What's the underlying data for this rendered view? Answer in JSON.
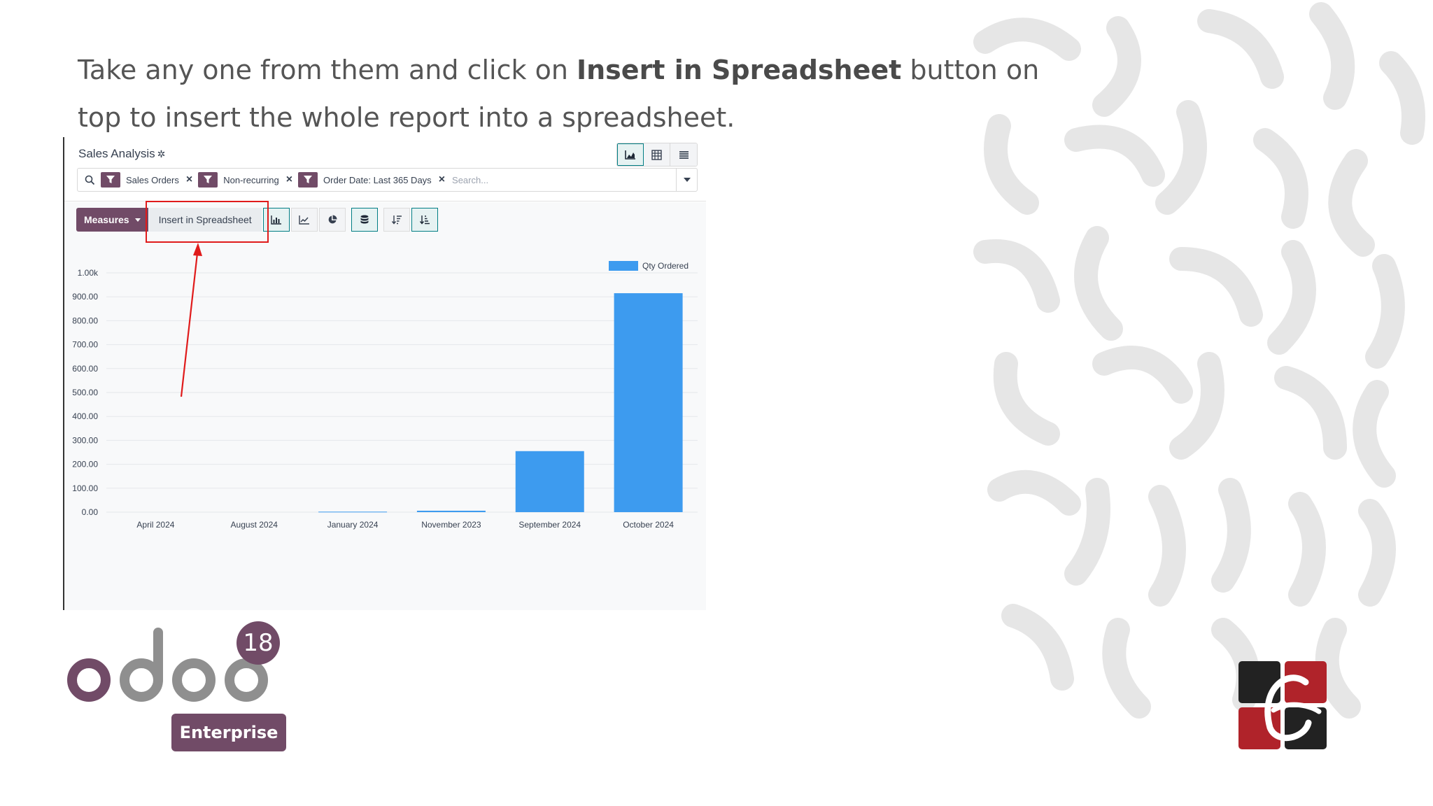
{
  "caption": {
    "part1": "Take any one from them and click on ",
    "bold": "Insert in Spreadsheet",
    "part2": " button on top to insert the whole report into a spreadsheet."
  },
  "odoo_app": {
    "page_title": "Sales Analysis",
    "view_switcher": [
      "graph-view-icon",
      "pivot-view-icon",
      "list-view-icon"
    ],
    "search": {
      "facets": [
        {
          "label": "Sales Orders",
          "icon": "filter-icon"
        },
        {
          "label": "Non-recurring",
          "icon": "filter-icon"
        },
        {
          "label": "Order Date: Last 365 Days",
          "icon": "filter-icon"
        }
      ],
      "placeholder": "Search..."
    },
    "toolbar": {
      "measures_label": "Measures",
      "insert_label": "Insert in Spreadsheet"
    }
  },
  "chart_data": {
    "type": "bar",
    "categories": [
      "April 2024",
      "August 2024",
      "January 2024",
      "November 2023",
      "September 2024",
      "October 2024"
    ],
    "series": [
      {
        "name": "Qty Ordered",
        "values": [
          0,
          0,
          2,
          6,
          255,
          915
        ],
        "color": "#3d9bef"
      }
    ],
    "yticks": [
      "0.00",
      "100.00",
      "200.00",
      "300.00",
      "400.00",
      "500.00",
      "600.00",
      "700.00",
      "800.00",
      "900.00",
      "1.00k"
    ],
    "ylim": [
      0,
      1000
    ],
    "legend_position": "top-right",
    "grid": true
  },
  "branding": {
    "logo_text": "odoo",
    "version": "18",
    "edition": "Enterprise",
    "brand_color": "#714b67"
  }
}
